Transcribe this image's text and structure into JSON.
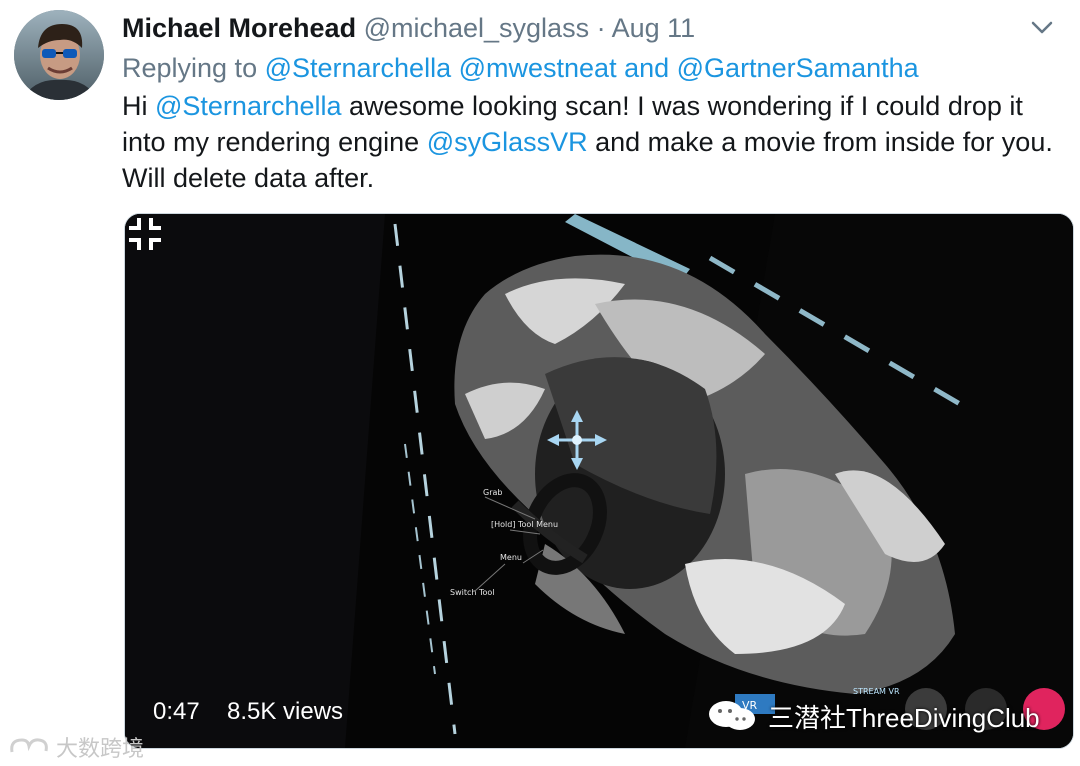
{
  "tweet": {
    "author_name": "Michael Morehead",
    "handle": "@michael_syglass",
    "separator": "·",
    "date": "Aug 11",
    "replying_prefix": "Replying to ",
    "replying_user_1": "@Sternarchella",
    "replying_user_2": "@mwestneat",
    "replying_and": " and ",
    "replying_user_3": "@GartnerSamantha",
    "text_part_1": "Hi ",
    "mention_1": "@Sternarchella",
    "text_part_2": " awesome looking scan! I was wondering if I could drop it into my rendering engine ",
    "mention_2": "@syGlassVR",
    "text_part_3": " and make a movie from inside for you. Will delete data after."
  },
  "video": {
    "duration": "0:47",
    "views": "8.5K views",
    "labels": {
      "grab": "Grab",
      "tool_menu": "[Hold] Tool Menu",
      "menu": "Menu",
      "switch_tool": "Switch Tool",
      "stream_vr": "STREAM VR",
      "vr": "VR"
    }
  },
  "watermarks": {
    "channel": "三潜社ThreeDivingClub",
    "bottom": "大数跨境"
  },
  "colors": {
    "link": "#1b95e0",
    "muted": "#657786",
    "video_bg": "#050505",
    "accent_red": "#e0245e"
  },
  "icons": {
    "chevron": "chevron-down-icon",
    "collapse": "collapse-icon",
    "move": "move-arrows-icon"
  }
}
